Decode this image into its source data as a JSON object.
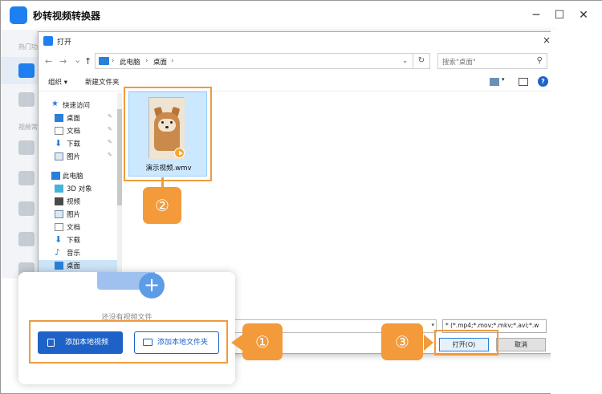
{
  "app": {
    "title": "秒转视频转换器",
    "side_labels": [
      "热门功",
      "视频常"
    ],
    "win_min": "─",
    "win_max": "☐",
    "win_close": "✕"
  },
  "dialog": {
    "title": "打开",
    "close": "×",
    "nav": {
      "back": "←",
      "forward": "→",
      "recent": "⌄",
      "up": "↑"
    },
    "breadcrumb": [
      "此电脑",
      "桌面"
    ],
    "breadcrumb_sep": "›",
    "search_placeholder": "搜索\"桌面\"",
    "toolbar": {
      "organize": "组织 ▾",
      "new_folder": "新建文件夹"
    },
    "help": "?",
    "tree": [
      {
        "label": "快速访问",
        "icon": "star-icon",
        "pinned": false
      },
      {
        "label": "桌面",
        "icon": "desktop-icon",
        "pinned": true
      },
      {
        "label": "文档",
        "icon": "document-icon",
        "pinned": true
      },
      {
        "label": "下载",
        "icon": "download-icon",
        "pinned": true
      },
      {
        "label": "图片",
        "icon": "picture-icon",
        "pinned": true
      },
      {
        "label": "此电脑",
        "icon": "computer-icon",
        "pinned": false
      },
      {
        "label": "3D 对象",
        "icon": "cube-icon",
        "pinned": false
      },
      {
        "label": "视频",
        "icon": "video-icon",
        "pinned": false
      },
      {
        "label": "图片",
        "icon": "picture-icon",
        "pinned": false
      },
      {
        "label": "文档",
        "icon": "document-icon",
        "pinned": false
      },
      {
        "label": "下载",
        "icon": "download-icon",
        "pinned": false
      },
      {
        "label": "音乐",
        "icon": "music-icon",
        "pinned": false
      },
      {
        "label": "桌面",
        "icon": "desktop-icon",
        "pinned": false
      }
    ],
    "pin_glyph": "📌",
    "file": {
      "name": "演示视频.wmv"
    },
    "filetype": "* (*.mp4;*.mov;*.mkv;*.avi;*.w",
    "open_button": "打开(O)",
    "cancel_button": "取消"
  },
  "upload": {
    "plus": "+",
    "empty_text": "还没有视频文件",
    "add_local": "添加本地视频",
    "add_folder": "添加本地文件夹"
  },
  "steps": {
    "one": "①",
    "two": "②",
    "three": "③"
  },
  "colors": {
    "accent": "#1e62c8",
    "highlight": "#f09a3e"
  }
}
